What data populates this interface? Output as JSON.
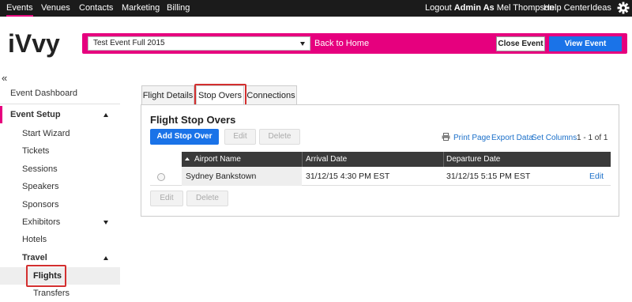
{
  "topnav": {
    "items": [
      "Events",
      "Venues",
      "Contacts",
      "Marketing",
      "Billing"
    ],
    "logout_prefix": "Logout",
    "admin_as": "Admin As",
    "user": "Mel Thompson",
    "help": "Help Center",
    "ideas": "Ideas",
    "gear_icon": "gear-icon"
  },
  "brand": {
    "logo_text": "iVvy",
    "accent": "#e6007e",
    "primary": "#1a73e8",
    "highlight": "#d32f2f"
  },
  "eventbar": {
    "selected_event": "Test Event Full 2015",
    "back": "Back to Home",
    "close": "Close Event",
    "view": "View Event Website"
  },
  "sidebar": {
    "collapse": "«",
    "dashboard": "Event Dashboard",
    "event_setup": "Event Setup",
    "items": [
      "Start Wizard",
      "Tickets",
      "Sessions",
      "Speakers",
      "Sponsors",
      "Exhibitors",
      "Hotels"
    ],
    "travel": "Travel",
    "flights": "Flights",
    "transfers": "Transfers"
  },
  "tabs": [
    "Flight Details",
    "Stop Overs",
    "Connections"
  ],
  "panel": {
    "title": "Flight Stop Overs",
    "add": "Add Stop Over",
    "edit": "Edit",
    "delete": "Delete",
    "print": "Print Page",
    "export": "Export Data",
    "set_columns": "Set Columns",
    "page_count": "1 - 1 of 1"
  },
  "table": {
    "columns": [
      "Airport Name",
      "Arrival Date",
      "Departure Date"
    ],
    "rows": [
      {
        "airport": "Sydney Bankstown",
        "arrival": "31/12/15 4:30 PM EST",
        "departure": "31/12/15 5:15 PM EST",
        "action": "Edit"
      }
    ]
  }
}
